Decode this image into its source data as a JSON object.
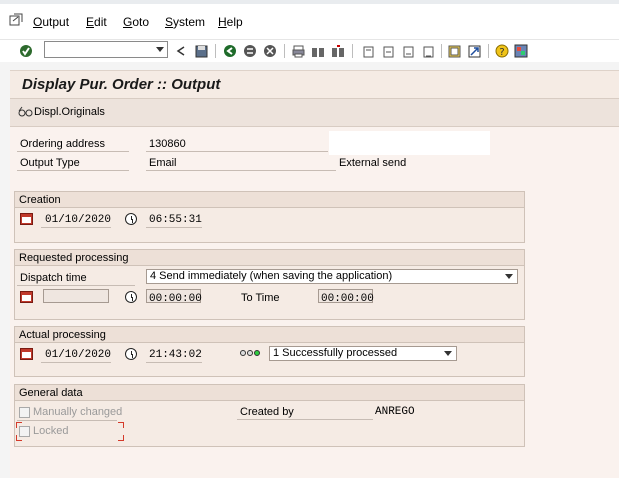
{
  "menu": {
    "items": [
      "Output",
      "Edit",
      "Goto",
      "System",
      "Help"
    ]
  },
  "toolbar": {
    "command_field_value": "",
    "icons": [
      "enter-icon",
      "back-icon",
      "save-icon",
      "back-green-icon",
      "exit-icon",
      "cancel-icon",
      "print-icon",
      "find-icon",
      "find-next-icon",
      "first-page-icon",
      "prev-page-icon",
      "next-page-icon",
      "last-page-icon",
      "create-session-icon",
      "shortcut-icon",
      "help-icon",
      "customize-layout-icon"
    ]
  },
  "title": "Display Pur. Order :: Output",
  "app_toolbar": {
    "displ_originals_label": "Displ.Originals"
  },
  "header": {
    "ordering_address_label": "Ordering address",
    "ordering_address_value": "130860",
    "output_type_label": "Output Type",
    "output_type_value": "Email",
    "external_send_label": "External send"
  },
  "creation": {
    "title": "Creation",
    "date": "01/10/2020",
    "time": "06:55:31"
  },
  "requested": {
    "title": "Requested processing",
    "dispatch_label": "Dispatch time",
    "dispatch_value": "4 Send immediately (when saving the application)",
    "date_value": "",
    "time_value": "00:00:00",
    "to_time_label": "To Time",
    "to_time_value": "00:00:00"
  },
  "actual": {
    "title": "Actual processing",
    "date": "01/10/2020",
    "time": "21:43:02",
    "status_value": "1 Successfully processed"
  },
  "general": {
    "title": "General data",
    "manually_changed_label": "Manually changed",
    "locked_label": "Locked",
    "created_by_label": "Created by",
    "created_by_value": "ANREGO"
  },
  "colors": {
    "title_band": "#f5ebe4",
    "group_bg": "#f5ebe4",
    "main_bg": "#faf2ee",
    "status_green": "#2ecc40"
  }
}
